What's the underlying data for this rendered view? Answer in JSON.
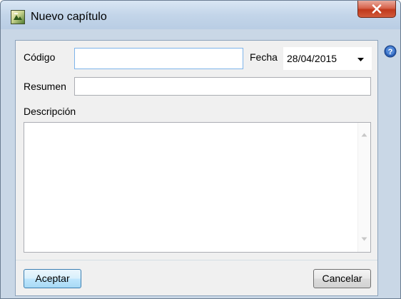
{
  "window": {
    "title": "Nuevo capítulo"
  },
  "form": {
    "codigo_label": "Código",
    "codigo_value": "",
    "fecha_label": "Fecha",
    "fecha_value": "28/04/2015",
    "resumen_label": "Resumen",
    "resumen_value": "",
    "descripcion_label": "Descripción",
    "descripcion_value": ""
  },
  "buttons": {
    "accept_label": "Aceptar",
    "cancel_label": "Cancelar"
  },
  "icons": {
    "app": "app-icon",
    "close": "close-icon",
    "help": "help-icon",
    "dropdown": "chevron-down-icon",
    "scroll_up": "scroll-up-icon",
    "scroll_down": "scroll-down-icon"
  },
  "colors": {
    "close_button": "#c0391c",
    "default_button_border": "#3c7fb1",
    "focused_field_border": "#7eb4ea",
    "help_icon": "#2a5fb5"
  }
}
